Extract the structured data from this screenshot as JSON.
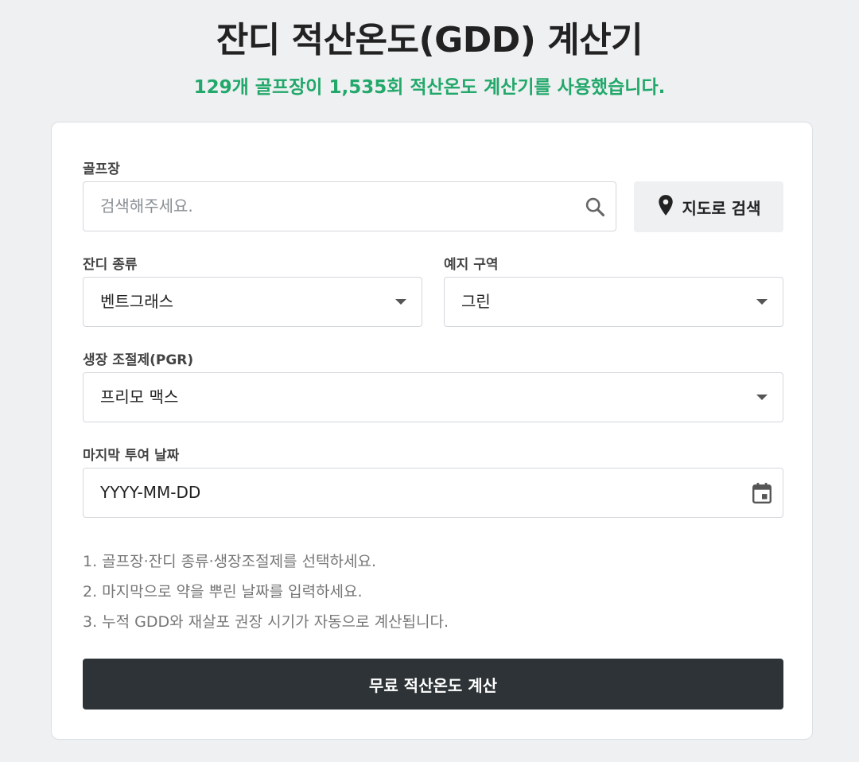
{
  "header": {
    "title": "잔디 적산온도(GDD) 계산기",
    "usage": "129개 골프장이 1,535회 적산온도 계산기를 사용했습니다."
  },
  "form": {
    "golf_course": {
      "label": "골프장",
      "placeholder": "검색해주세요.",
      "map_button": "지도로 검색"
    },
    "grass_type": {
      "label": "잔디 종류",
      "value": "벤트그래스"
    },
    "mowing_zone": {
      "label": "예지 구역",
      "value": "그린"
    },
    "pgr": {
      "label": "생장 조절제(PGR)",
      "value": "프리모 맥스"
    },
    "last_date": {
      "label": "마지막 투여 날짜",
      "value": "YYYY-MM-DD"
    },
    "steps": [
      "1. 골프장·잔디 종류·생장조절제를 선택하세요.",
      "2. 마지막으로 약을 뿌린 날짜를 입력하세요.",
      "3. 누적 GDD와 재살포 권장 시기가 자동으로 계산됩니다."
    ],
    "submit": "무료 적산온도 계산"
  },
  "colors": {
    "accent": "#22a86a",
    "button_dark": "#2d3336",
    "background": "#eef0f2"
  }
}
